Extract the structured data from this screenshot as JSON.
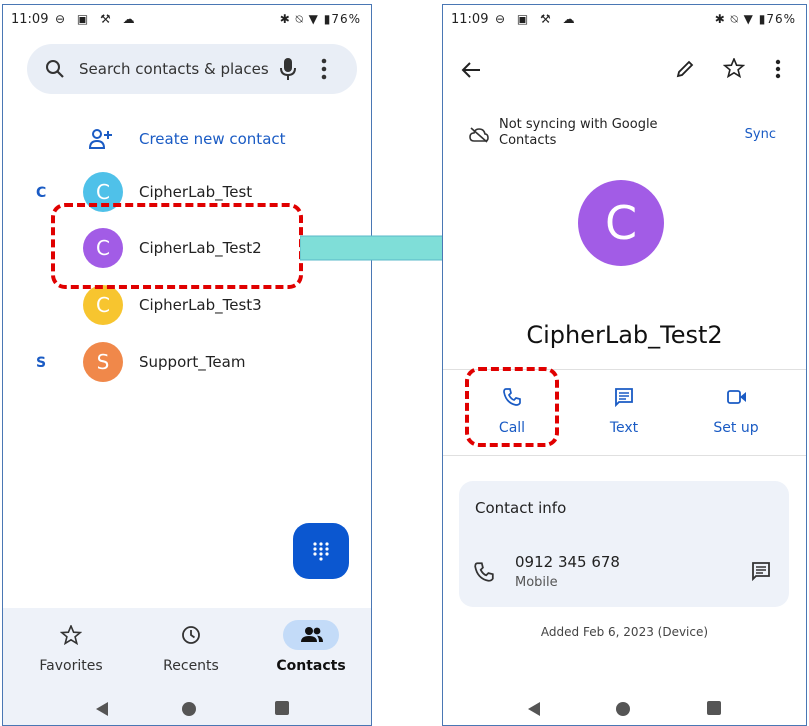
{
  "status_bar": {
    "time": "11:09",
    "left_icons": "⊖ ▣ ⚒ ☁",
    "right_icons": "✱ ⍉ ▼ ▮76%"
  },
  "left_screen": {
    "search": {
      "placeholder": "Search contacts & places"
    },
    "create_label": "Create new contact",
    "sections": [
      {
        "letter": "C"
      },
      {
        "letter": "S"
      }
    ],
    "contacts": [
      {
        "initial": "C",
        "name": "CipherLab_Test",
        "color": "#4fc1e9"
      },
      {
        "initial": "C",
        "name": "CipherLab_Test2",
        "color": "#a25ce6"
      },
      {
        "initial": "C",
        "name": "CipherLab_Test3",
        "color": "#f7c52f"
      },
      {
        "initial": "S",
        "name": "Support_Team",
        "color": "#f0884a"
      }
    ],
    "nav": [
      {
        "label": "Favorites",
        "icon": "star-icon"
      },
      {
        "label": "Recents",
        "icon": "clock-icon"
      },
      {
        "label": "Contacts",
        "icon": "people-icon",
        "active": true
      }
    ]
  },
  "right_screen": {
    "sync_message": "Not syncing with Google Contacts",
    "sync_button": "Sync",
    "avatar_initial": "C",
    "contact_name": "CipherLab_Test2",
    "actions": [
      {
        "label": "Call",
        "icon": "phone-icon"
      },
      {
        "label": "Text",
        "icon": "message-icon"
      },
      {
        "label": "Set up",
        "icon": "video-icon"
      }
    ],
    "contact_info_title": "Contact info",
    "phone_number": "0912 345 678",
    "phone_type": "Mobile",
    "added_text": "Added Feb 6, 2023 (Device)"
  },
  "colors": {
    "accent_blue": "#1a5bc4",
    "fab_blue": "#0b57d0",
    "highlight_red": "#e00000",
    "arrow_teal": "#7fded8"
  }
}
